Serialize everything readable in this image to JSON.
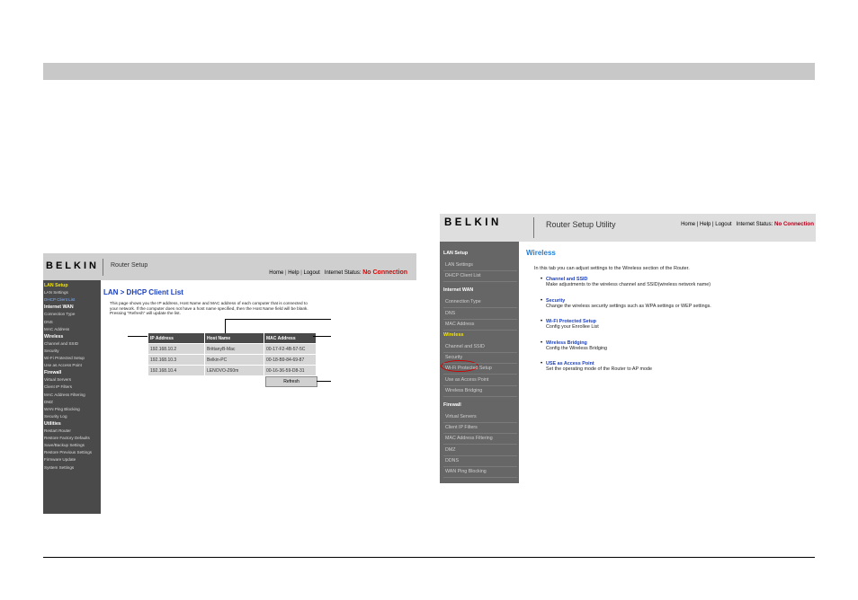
{
  "left_shot": {
    "logo": "BELKIN",
    "app_title": "Router Setup",
    "nav": {
      "home": "Home",
      "help": "Help",
      "logout": "Logout",
      "status_label": "Internet Status:",
      "status_value": "No Connection",
      "sep": "|"
    },
    "sidebar": [
      {
        "label": "LAN Setup",
        "kind": "yellow"
      },
      {
        "label": "LAN Settings",
        "kind": "item"
      },
      {
        "label": "DHCP Client List",
        "kind": "active"
      },
      {
        "label": "Internet WAN",
        "kind": "header"
      },
      {
        "label": "Connection Type",
        "kind": "item"
      },
      {
        "label": "DNS",
        "kind": "item"
      },
      {
        "label": "MAC Address",
        "kind": "item"
      },
      {
        "label": "Wireless",
        "kind": "header"
      },
      {
        "label": "Channel and SSID",
        "kind": "item"
      },
      {
        "label": "Security",
        "kind": "item"
      },
      {
        "label": "Wi-Fi Protected Setup",
        "kind": "item"
      },
      {
        "label": "Use as Access Point",
        "kind": "item"
      },
      {
        "label": "Firewall",
        "kind": "header"
      },
      {
        "label": "Virtual Servers",
        "kind": "item"
      },
      {
        "label": "Client IP Filters",
        "kind": "item"
      },
      {
        "label": "MAC Address Filtering",
        "kind": "item"
      },
      {
        "label": "DMZ",
        "kind": "item"
      },
      {
        "label": "WAN Ping Blocking",
        "kind": "item"
      },
      {
        "label": "Security Log",
        "kind": "item"
      },
      {
        "label": "Utilities",
        "kind": "header"
      },
      {
        "label": "Restart Router",
        "kind": "item"
      },
      {
        "label": "Restore Factory Defaults",
        "kind": "item"
      },
      {
        "label": "Save/Backup Settings",
        "kind": "item"
      },
      {
        "label": "Restore Previous Settings",
        "kind": "item"
      },
      {
        "label": "Firmware Update",
        "kind": "item"
      },
      {
        "label": "System Settings",
        "kind": "item"
      }
    ],
    "heading": "LAN > DHCP Client List",
    "description_lines": [
      "This page shows you the IP address, Host Name and MAC address of each computer that is connected to",
      "your network. If the computer does not have a host name specified, then the Host Name field will be blank.",
      "Pressing \"Refresh\" will update the list."
    ],
    "table": {
      "headers": [
        "IP Address",
        "Host Name",
        "MAC Address"
      ],
      "rows": [
        [
          "192.168.10.2",
          "BrittanyB-Mac",
          "00-17-F2-4B-57-5C"
        ],
        [
          "192.168.10.3",
          "Belkin-PC",
          "00-18-B9-84-69-87"
        ],
        [
          "192.168.10.4",
          "LENOVO-Z60m",
          "00-16-36-59-D8-31"
        ]
      ]
    },
    "refresh_label": "Refresh"
  },
  "right_shot": {
    "logo": "BELKIN",
    "app_title": "Router Setup Utility",
    "nav": {
      "home": "Home",
      "help": "Help",
      "logout": "Logout",
      "status_label": "Internet Status:",
      "status_value": "No Connection",
      "sep": "|"
    },
    "sidebar": [
      {
        "label": "LAN Setup",
        "kind": "header"
      },
      {
        "label": "LAN Settings",
        "kind": "item"
      },
      {
        "label": "DHCP Client List",
        "kind": "item"
      },
      {
        "label": "Internet WAN",
        "kind": "header"
      },
      {
        "label": "Connection Type",
        "kind": "item"
      },
      {
        "label": "DNS",
        "kind": "item"
      },
      {
        "label": "MAC Address",
        "kind": "item"
      },
      {
        "label": "Wireless",
        "kind": "yellow"
      },
      {
        "label": "Channel and SSID",
        "kind": "item"
      },
      {
        "label": "Security",
        "kind": "item"
      },
      {
        "label": "Wi-Fi Protected Setup",
        "kind": "item"
      },
      {
        "label": "Use as Access Point",
        "kind": "item"
      },
      {
        "label": "Wireless Bridging",
        "kind": "item"
      },
      {
        "label": "Firewall",
        "kind": "header"
      },
      {
        "label": "Virtual Servers",
        "kind": "item"
      },
      {
        "label": "Client IP Filters",
        "kind": "item"
      },
      {
        "label": "MAC Address Filtering",
        "kind": "item"
      },
      {
        "label": "DMZ",
        "kind": "item"
      },
      {
        "label": "DDNS",
        "kind": "item"
      },
      {
        "label": "WAN Ping Blocking",
        "kind": "item"
      }
    ],
    "heading": "Wireless",
    "intro": "In this tab you can adjust settings to the Wireless section of the Router.",
    "items": [
      {
        "title": "Channel and SSID",
        "desc": "Make adjustments to the wireless channel and SSID(wireless network name)"
      },
      {
        "title": "Security",
        "desc": "Change the wireless security settings such as WPA settings or WEP settings."
      },
      {
        "title": "Wi-Fi Protected Setup",
        "desc": "Config your Enrollee List"
      },
      {
        "title": "Wireless Bridging",
        "desc": "Config the Wireless Bridging"
      },
      {
        "title": "USE as Access Point",
        "desc": "Set the operating mode of the Router to AP mode"
      }
    ]
  },
  "colors": {
    "belkin_blue": "#1a3fbf",
    "wireless_heading": "#1f7fd6",
    "no_connection": "#e00000",
    "sidebar_yellow": "#f2e400"
  }
}
